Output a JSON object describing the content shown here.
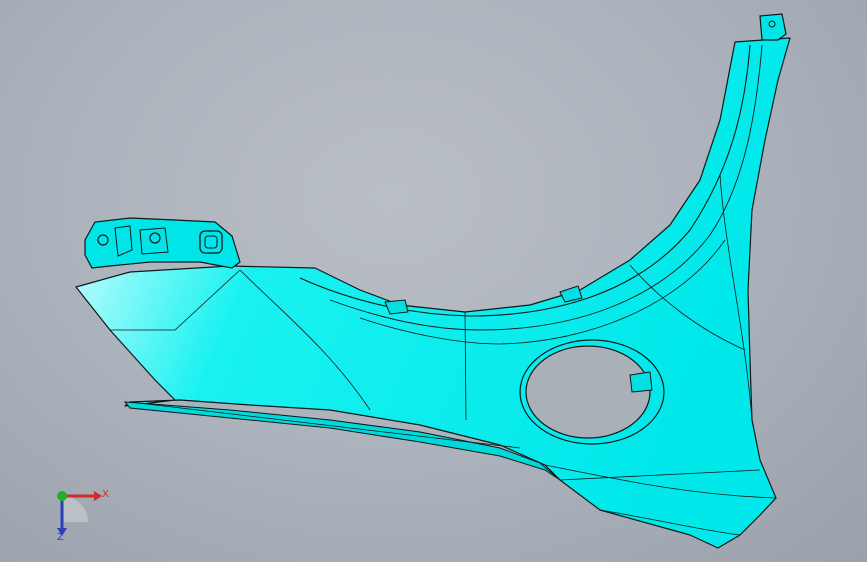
{
  "viewport": {
    "background_top": "#b9bec6",
    "background_bottom": "#9aa1ab"
  },
  "model": {
    "part_fill": "#00f2f2",
    "part_highlight": "#eaffff",
    "edge_color": "#0b1a1a"
  },
  "triad": {
    "x_label": "X",
    "z_label": "Z",
    "x_color": "#d22b2b",
    "y_color": "#22b022",
    "z_color": "#2a3fb8"
  }
}
